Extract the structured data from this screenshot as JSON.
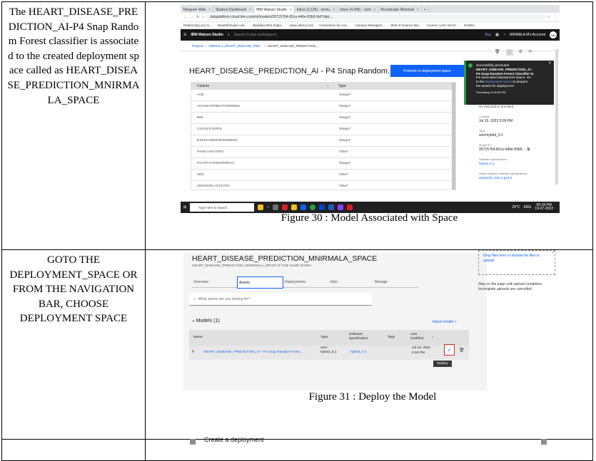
{
  "row1": {
    "left_text": "The HEART_DISEASE_PREDICTION_AI-P4 Snap Random Forest classifier is associated to the created deployment space called as HEART_DISEASE_PREDICTION_MNIRMALA_SPACE",
    "caption": "Figure 30 : Model Associated with Space",
    "screenshot": {
      "tabs": [
        "Telegram Web",
        "Student Dashboard",
        "IBM Watson Studio",
        "Inbox (2,126) - nirmu",
        "Inbox (4,435) - nirm",
        "Roundcube Webmail"
      ],
      "address": "dataplatform.cloud.ibm.com/ml/models/26715764-82ca-446e-83b9-9ef7dab...",
      "bookmarks": [
        "Redirecting you to...",
        "Beadsforhope Live...",
        "Beading Wire Expla...",
        "www.udemy.com",
        "Consortium for Aca...",
        "Campus Managem...",
        "Web of Science Ma...",
        "Course | Let's Get R...",
        "NVIDIA"
      ],
      "app_name": "IBM Watson Studio",
      "search_placeholder": "Search in your workspaces",
      "buy": "Buy",
      "account": "NIRMALA M's Account",
      "avatar": "NM",
      "breadcrumb": [
        "Projects",
        "NIRMALA_HEART_DISEASE_PRE...",
        "HEART_DISEASE_PREDICTION_..."
      ],
      "title": "HEART_DISEASE_PREDICTION_AI - P4 Snap Random...",
      "promote_button": "Promote to deployment space",
      "toast": {
        "line1": "Successfully promoted",
        "line2": "HEART_DISEASE_PREDICTION_AI -",
        "line3": "P4 Snap Random Forest Classifier to",
        "line4": "the associated deployment space. Go",
        "line5_pre": "to the",
        "line5_link": "deployment space",
        "line5_post": "to prepare",
        "line6": "the assets for deployment.",
        "timestamp": "Timestamp 5:18:06 PM"
      },
      "schema_header": {
        "col": "Column",
        "type": "Type"
      },
      "schema_rows": [
        {
          "col": "AGE",
          "type": "\"integer\""
        },
        {
          "col": "AVGHEARTBEATSPERMIN",
          "type": "\"integer\""
        },
        {
          "col": "BMI",
          "type": "\"integer\""
        },
        {
          "col": "CHOLESTEROL",
          "type": "\"integer\""
        },
        {
          "col": "EXERCISEMINPERWEEK",
          "type": "\"integer\""
        },
        {
          "col": "FAMILYHISTORY",
          "type": "\"other\""
        },
        {
          "col": "PALPITATIONSPERDAY",
          "type": "\"integer\""
        },
        {
          "col": "SEX",
          "type": "\"other\""
        },
        {
          "col": "SMOKERLASTSYRS",
          "type": "\"other\""
        }
      ],
      "side": {
        "desc": "No description provided.",
        "created_label": "Created",
        "created": "Jul 19, 2022 5:09 PM",
        "type_label": "Type",
        "type": "wml-hybrid_0.1",
        "model_id_label": "Model ID",
        "model_id": "26715764-82ca-446e-83b9-...",
        "sw_label": "Software specification",
        "sw": "hybrid_0.1",
        "hybrid_label": "Hybrid pipeline software specifications",
        "hybrid": "autoai-kb_rt22.1-py3.9"
      },
      "taskbar": {
        "search": "Type here to search",
        "temp": "29°C",
        "lang": "ENG",
        "time": "05:18 PM",
        "date": "19-07-2022"
      }
    }
  },
  "row2": {
    "left_text": "GOTO THE DEPLOYMENT_SPACE OR FROM THE NAVIGATION BAR, CHOOSE DEPLOYMENT SPACE",
    "caption": "Figure 31 : Deploy the Model",
    "screenshot": {
      "title": "HEART_DISEASE_PREDICTION_MNIRMALA_SPACE",
      "subtitle": "HEART_DISEASE_PREDICTION_MNIRMALA_SPACE IS THE NAME GIVEN",
      "tabs": [
        "Overview",
        "Assets",
        "Deployments",
        "Jobs",
        "Manage"
      ],
      "active_tab": "Assets",
      "search_placeholder": "What assets are you looking for?",
      "models_label": "Models (1)",
      "import_model": "Import model +",
      "headers": {
        "name": "Name",
        "type": "Type",
        "sw": "Software specification",
        "tags": "Tags",
        "modified": "Last modified"
      },
      "row": {
        "name": "HEART_DISEASE_PREDICTION_AI - P4 Snap Random Fores...",
        "type": "wml-hybrid_0.1",
        "sw": "hybrid_0.1",
        "modified_date": "Jul 19, 2022",
        "modified_time": "5:18 PM"
      },
      "tooltip": "Deploy",
      "upload_text": "Drop files here or browse for files to upload.",
      "upload_note": "Stay on the page until upload completes. Incomplete uploads are cancelled."
    }
  },
  "row3": {
    "partial_text": "Create a deployment"
  }
}
